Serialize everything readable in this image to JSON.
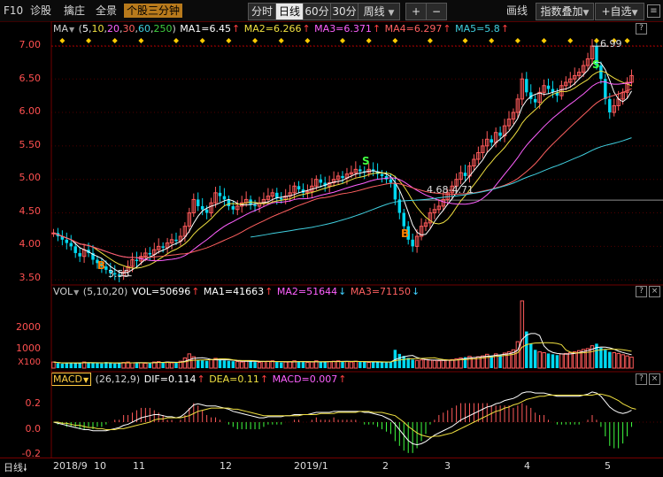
{
  "toolbar": {
    "f10": "F10",
    "zhengu": "诊股",
    "zhubi": "擒庄",
    "quanjing": "全景",
    "gegu": "个股三分钟",
    "periods": [
      "分时",
      "日线",
      "60分",
      "30分",
      "周线"
    ],
    "selected_period": "日线",
    "plus": "+",
    "minus": "−",
    "huaxian": "画线",
    "zhibiao": "指数叠加",
    "zixuan": "+自选"
  },
  "legend_ma": {
    "name": "MA",
    "params_open": "(",
    "p1": "5",
    "p2": "10",
    "p3": "20",
    "p4": "30",
    "p5": "60",
    "p6": "250",
    "params_close": ")",
    "ma1": "MA1=6.45",
    "ma2": "MA2=6.266",
    "ma3": "MA3=6.371",
    "ma4": "MA4=6.297",
    "ma5": "MA5=5.8",
    "arrow": "↑"
  },
  "legend_vol": {
    "name": "VOL",
    "params": "(5,10,20)",
    "vol": "VOL=50696",
    "ma1": "MA1=41663",
    "ma2": "MA2=51644",
    "ma3": "MA3=71150",
    "up": "↑",
    "down": "↓"
  },
  "legend_macd": {
    "name": "MACD",
    "params": "(26,12,9)",
    "dif": "DIF=0.114",
    "dea": "DEA=0.11",
    "macd": "MACD=0.007",
    "up": "↑"
  },
  "question_mark": "?",
  "close_mark": "×",
  "price_axis": [
    "7.00",
    "6.50",
    "6.00",
    "5.50",
    "5.00",
    "4.50",
    "4.00",
    "3.50"
  ],
  "vol_axis": [
    "2000",
    "1000"
  ],
  "vol_unit": "X100",
  "macd_axis": [
    "0.2",
    "0.0",
    "-0.2"
  ],
  "x_labels": [
    "2018/9",
    "10",
    "11",
    "12",
    "2019/1",
    "2",
    "3",
    "4",
    "5"
  ],
  "bottom_label": "日线",
  "annotations": {
    "high": "6.99",
    "low": "3.55",
    "mid": "4.68-4.71",
    "buy": "B",
    "sell": "S"
  },
  "colors": {
    "up": "#ff5a5a",
    "down": "#00d8f0",
    "ma1": "#ffffff",
    "ma2": "#f0e040",
    "ma3": "#ff60ff",
    "ma4": "#ff6060",
    "ma5": "#40d0e0",
    "signal": "#ffcc00"
  },
  "chart_data": {
    "type": "candlestick",
    "price_range": [
      3.45,
      7.15
    ],
    "closes": [
      4.2,
      4.15,
      4.1,
      4.05,
      4.0,
      3.9,
      3.85,
      3.95,
      3.9,
      3.8,
      3.75,
      3.7,
      3.65,
      3.6,
      3.58,
      3.56,
      3.62,
      3.7,
      3.8,
      3.78,
      3.85,
      3.9,
      3.88,
      3.95,
      4.0,
      3.98,
      4.05,
      4.1,
      4.08,
      4.15,
      4.3,
      4.5,
      4.7,
      4.6,
      4.55,
      4.5,
      4.65,
      4.8,
      4.75,
      4.7,
      4.6,
      4.55,
      4.6,
      4.65,
      4.7,
      4.62,
      4.6,
      4.65,
      4.7,
      4.75,
      4.8,
      4.72,
      4.7,
      4.75,
      4.8,
      4.9,
      4.85,
      4.8,
      4.82,
      4.9,
      5.0,
      4.95,
      4.9,
      4.95,
      5.0,
      5.05,
      5.02,
      5.08,
      5.1,
      5.15,
      5.12,
      5.1,
      5.15,
      5.12,
      5.08,
      5.05,
      5.0,
      4.95,
      4.7,
      4.5,
      4.3,
      4.1,
      4.0,
      4.15,
      4.3,
      4.35,
      4.5,
      4.55,
      4.6,
      4.7,
      4.8,
      4.9,
      5.0,
      5.1,
      5.05,
      5.2,
      5.3,
      5.4,
      5.5,
      5.6,
      5.55,
      5.7,
      5.65,
      5.8,
      5.9,
      6.0,
      6.2,
      6.5,
      6.3,
      6.2,
      6.15,
      6.3,
      6.4,
      6.35,
      6.3,
      6.25,
      6.4,
      6.45,
      6.5,
      6.55,
      6.6,
      6.7,
      6.8,
      6.99,
      6.7,
      6.5,
      6.2,
      6.0,
      6.1,
      6.2,
      6.3,
      6.45,
      6.55
    ],
    "volume_range": [
      0,
      3300
    ],
    "volumes": [
      300,
      250,
      220,
      260,
      280,
      240,
      260,
      300,
      280,
      260,
      240,
      230,
      300,
      260,
      220,
      250,
      280,
      300,
      260,
      270,
      260,
      240,
      280,
      300,
      320,
      280,
      300,
      260,
      280,
      340,
      500,
      700,
      560,
      400,
      380,
      360,
      420,
      480,
      400,
      380,
      360,
      340,
      320,
      300,
      360,
      380,
      300,
      280,
      320,
      340,
      360,
      300,
      280,
      300,
      320,
      360,
      340,
      300,
      280,
      300,
      360,
      320,
      300,
      320,
      340,
      360,
      340,
      320,
      300,
      340,
      320,
      300,
      280,
      300,
      320,
      300,
      280,
      300,
      900,
      700,
      600,
      500,
      420,
      380,
      400,
      420,
      400,
      380,
      360,
      380,
      400,
      420,
      460,
      500,
      540,
      580,
      520,
      560,
      600,
      680,
      620,
      700,
      660,
      740,
      800,
      900,
      1300,
      3300,
      1800,
      1200,
      900,
      800,
      760,
      720,
      680,
      640,
      700,
      720,
      760,
      800,
      860,
      920,
      960,
      1100,
      1200,
      1000,
      900,
      800,
      760,
      720,
      660,
      600,
      540
    ],
    "macd_range": [
      -0.32,
      0.32
    ],
    "dif": [
      0.0,
      -0.01,
      -0.02,
      -0.03,
      -0.04,
      -0.05,
      -0.06,
      -0.07,
      -0.07,
      -0.08,
      -0.08,
      -0.08,
      -0.08,
      -0.07,
      -0.06,
      -0.05,
      -0.03,
      -0.02,
      0.0,
      0.02,
      0.04,
      0.05,
      0.06,
      0.07,
      0.07,
      0.06,
      0.05,
      0.05,
      0.04,
      0.05,
      0.08,
      0.12,
      0.16,
      0.17,
      0.16,
      0.15,
      0.15,
      0.15,
      0.14,
      0.13,
      0.12,
      0.1,
      0.09,
      0.08,
      0.07,
      0.06,
      0.05,
      0.04,
      0.04,
      0.05,
      0.05,
      0.05,
      0.05,
      0.06,
      0.06,
      0.07,
      0.07,
      0.07,
      0.07,
      0.08,
      0.09,
      0.09,
      0.09,
      0.09,
      0.1,
      0.1,
      0.1,
      0.1,
      0.1,
      0.1,
      0.1,
      0.09,
      0.09,
      0.08,
      0.07,
      0.06,
      0.04,
      0.02,
      -0.02,
      -0.07,
      -0.12,
      -0.17,
      -0.2,
      -0.21,
      -0.2,
      -0.18,
      -0.15,
      -0.12,
      -0.1,
      -0.08,
      -0.06,
      -0.04,
      -0.01,
      0.02,
      0.04,
      0.06,
      0.08,
      0.1,
      0.12,
      0.14,
      0.15,
      0.17,
      0.18,
      0.2,
      0.21,
      0.22,
      0.24,
      0.27,
      0.28,
      0.28,
      0.27,
      0.27,
      0.27,
      0.26,
      0.25,
      0.24,
      0.24,
      0.24,
      0.24,
      0.24,
      0.24,
      0.25,
      0.26,
      0.28,
      0.27,
      0.24,
      0.19,
      0.14,
      0.11,
      0.09,
      0.08,
      0.09,
      0.11
    ],
    "dea": [
      0.0,
      0.0,
      -0.01,
      -0.01,
      -0.02,
      -0.03,
      -0.03,
      -0.04,
      -0.05,
      -0.05,
      -0.06,
      -0.06,
      -0.07,
      -0.07,
      -0.07,
      -0.06,
      -0.06,
      -0.05,
      -0.04,
      -0.03,
      -0.02,
      -0.01,
      0.0,
      0.02,
      0.03,
      0.03,
      0.04,
      0.04,
      0.04,
      0.04,
      0.05,
      0.06,
      0.08,
      0.1,
      0.11,
      0.12,
      0.13,
      0.13,
      0.13,
      0.13,
      0.13,
      0.12,
      0.12,
      0.11,
      0.1,
      0.09,
      0.08,
      0.07,
      0.06,
      0.06,
      0.06,
      0.06,
      0.06,
      0.06,
      0.06,
      0.06,
      0.06,
      0.07,
      0.07,
      0.07,
      0.07,
      0.08,
      0.08,
      0.08,
      0.08,
      0.09,
      0.09,
      0.09,
      0.09,
      0.09,
      0.1,
      0.1,
      0.1,
      0.09,
      0.09,
      0.09,
      0.08,
      0.07,
      0.06,
      0.03,
      0.0,
      -0.04,
      -0.07,
      -0.1,
      -0.12,
      -0.13,
      -0.14,
      -0.13,
      -0.13,
      -0.12,
      -0.11,
      -0.1,
      -0.08,
      -0.06,
      -0.04,
      -0.02,
      0.0,
      0.02,
      0.04,
      0.06,
      0.08,
      0.1,
      0.11,
      0.13,
      0.14,
      0.16,
      0.17,
      0.19,
      0.21,
      0.22,
      0.23,
      0.24,
      0.24,
      0.25,
      0.25,
      0.25,
      0.25,
      0.25,
      0.25,
      0.25,
      0.25,
      0.25,
      0.25,
      0.25,
      0.26,
      0.26,
      0.25,
      0.24,
      0.22,
      0.2,
      0.17,
      0.15,
      0.13,
      0.12
    ]
  }
}
